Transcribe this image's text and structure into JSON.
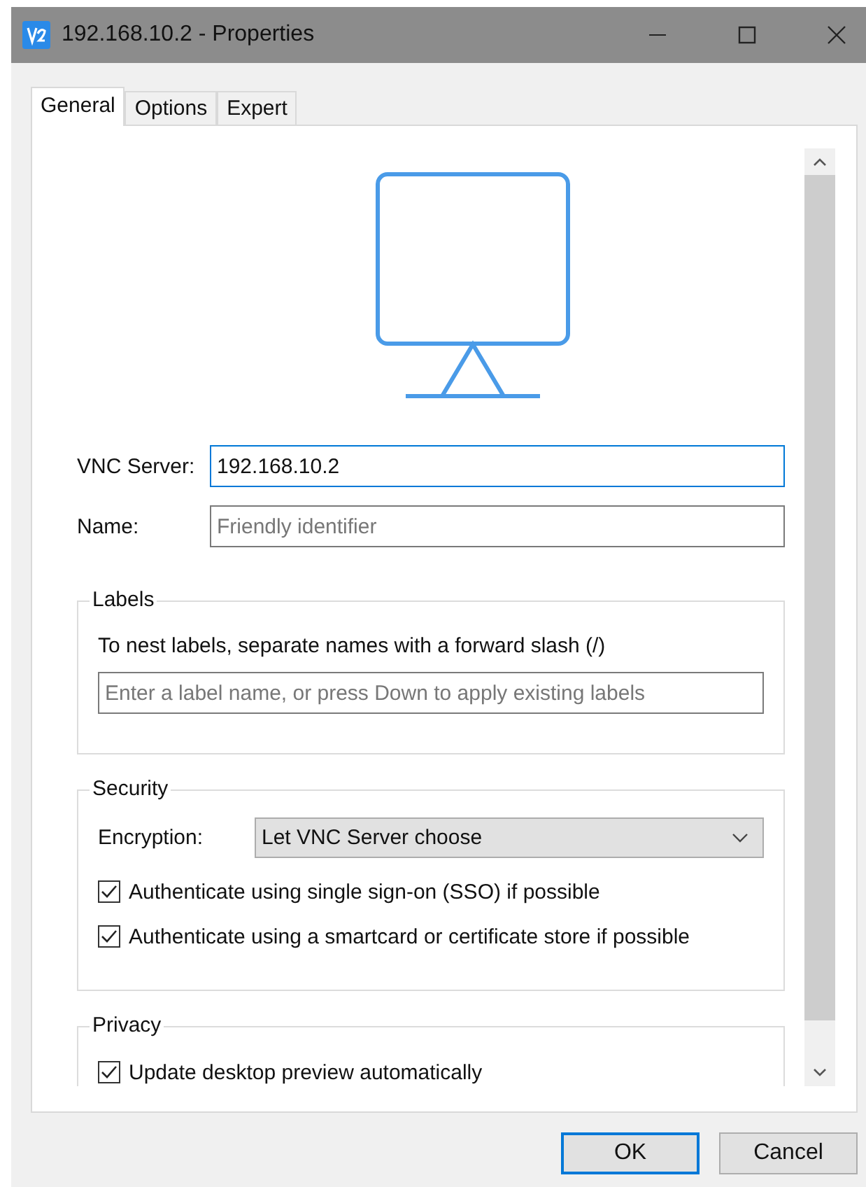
{
  "window": {
    "title": "192.168.10.2 - Properties"
  },
  "tabs": [
    {
      "label": "General",
      "selected": true
    },
    {
      "label": "Options",
      "selected": false
    },
    {
      "label": "Expert",
      "selected": false
    }
  ],
  "fields": [
    {
      "label": "VNC Server:",
      "value": "192.168.10.2",
      "focused": true
    },
    {
      "label": "Name:",
      "placeholder": "Friendly identifier",
      "focused": false
    }
  ],
  "labels_group": {
    "title": "Labels",
    "hint": "To nest labels, separate names with a forward slash (/)",
    "placeholder": "Enter a label name, or press Down to apply existing labels"
  },
  "security": {
    "title": "Security",
    "encryption": {
      "label": "Encryption:",
      "value": "Let VNC Server choose"
    },
    "options": [
      {
        "label": "Authenticate using single sign-on (SSO) if possible",
        "checked": true
      },
      {
        "label": "Authenticate using a smartcard or certificate store if possible",
        "checked": true
      }
    ]
  },
  "privacy": {
    "title": "Privacy",
    "options": [
      {
        "label": "Update desktop preview automatically",
        "checked": true
      }
    ]
  },
  "buttons": [
    {
      "label": "OK",
      "default": true
    },
    {
      "label": "Cancel",
      "default": false
    }
  ]
}
